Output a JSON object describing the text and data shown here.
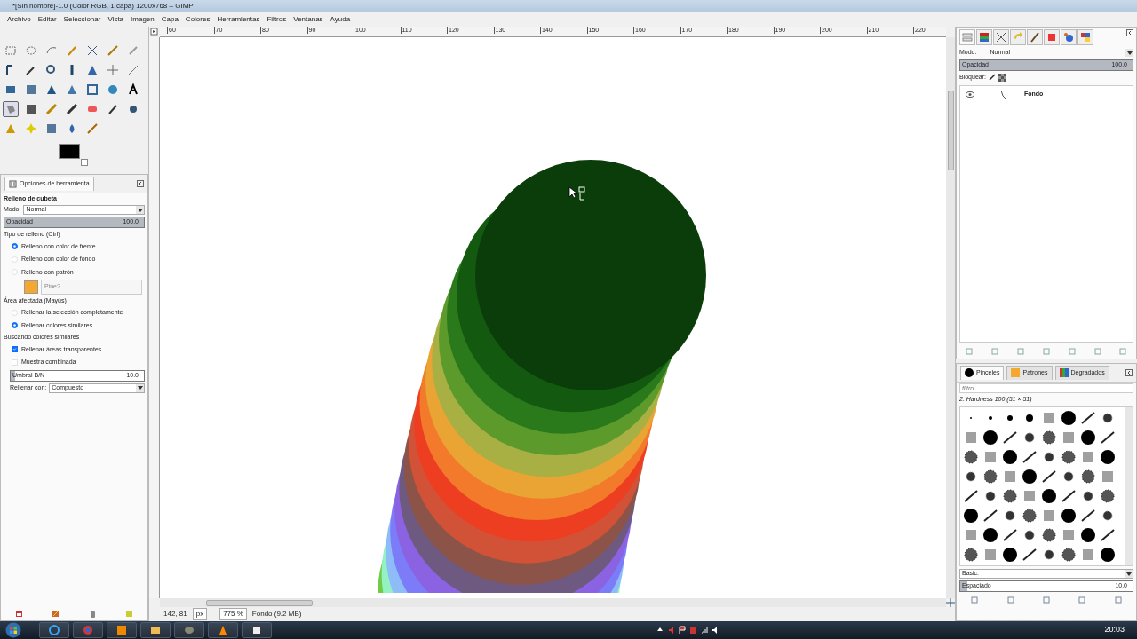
{
  "window": {
    "title": "*[Sin nombre]-1.0 (Color RGB, 1 capa) 1200x768 – GIMP"
  },
  "menu": [
    "Archivo",
    "Editar",
    "Seleccionar",
    "Vista",
    "Imagen",
    "Capa",
    "Colores",
    "Herramientas",
    "Filtros",
    "Ventanas",
    "Ayuda"
  ],
  "toolbox": {
    "tools": [
      {
        "selected": false
      },
      {
        "selected": false
      },
      {
        "selected": false
      },
      {
        "selected": false
      },
      {
        "selected": false
      },
      {
        "selected": false
      },
      {
        "selected": false
      },
      {
        "selected": false
      },
      {
        "selected": false
      },
      {
        "selected": false
      },
      {
        "selected": false
      },
      {
        "selected": false
      },
      {
        "selected": false
      },
      {
        "selected": false
      },
      {
        "selected": false
      },
      {
        "selected": false
      },
      {
        "selected": false
      },
      {
        "selected": false
      },
      {
        "selected": false
      },
      {
        "selected": false
      },
      {
        "selected": false
      },
      {
        "selected": true
      },
      {
        "selected": false
      },
      {
        "selected": false
      },
      {
        "selected": false
      },
      {
        "selected": false
      },
      {
        "selected": false
      },
      {
        "selected": false
      },
      {
        "selected": false
      },
      {
        "selected": false
      },
      {
        "selected": false
      },
      {
        "selected": false
      },
      {
        "selected": false
      }
    ]
  },
  "tool_options": {
    "tab": "Opciones de herramienta",
    "title": "Relleno de cubeta",
    "mode_label": "Modo:",
    "mode_value": "Normal",
    "opacity": {
      "label": "Opacidad",
      "value": "100.0",
      "level": 1.0
    },
    "fill_type_label": "Tipo de relleno  (Ctrl)",
    "fill_type": [
      {
        "label": "Relleno con color de frente",
        "selected": true
      },
      {
        "label": "Relleno con color de fondo",
        "selected": false
      },
      {
        "label": "Relleno con patrón",
        "selected": false
      }
    ],
    "pattern": "Pine?",
    "area_label": "Área afectada  (Mayús)",
    "area": [
      {
        "label": "Rellenar la selección completamente",
        "selected": false
      },
      {
        "label": "Rellenar colores similares",
        "selected": true
      }
    ],
    "similar_label": "Buscando colores similares",
    "checks": [
      {
        "label": "Rellenar áreas transparentes",
        "checked": true
      },
      {
        "label": "Muestra combinada",
        "checked": false
      }
    ],
    "threshold": {
      "label": "Umbral B/N",
      "value": "10.0",
      "level": 0.03
    },
    "fill_with_label": "Rellenar con:",
    "fill_with_value": "Compuesto"
  },
  "canvas": {
    "ruler_labels": [
      "60",
      "70",
      "80",
      "90",
      "100",
      "110",
      "120",
      "130",
      "140",
      "150",
      "160",
      "170",
      "180",
      "190",
      "200",
      "210",
      "220"
    ]
  },
  "status_bar": {
    "coords": "142, 81",
    "unit": "px",
    "zoom": "775 %",
    "info": "Fondo (9.2 MB)"
  },
  "layers": {
    "dock_tabs": [
      {
        "selected": true
      },
      {
        "selected": false
      },
      {
        "selected": false
      },
      {
        "selected": false
      },
      {
        "selected": false
      },
      {
        "selected": false
      },
      {
        "selected": false
      },
      {
        "selected": false
      }
    ],
    "mode_label": "Modo:",
    "mode_value": "Normal",
    "opacity": {
      "label": "Opacidad",
      "value": "100.0",
      "level": 1.0
    },
    "lock_label": "Bloquear:",
    "items": [
      {
        "name": "Fondo",
        "visible": true
      }
    ]
  },
  "brushes": {
    "tabs": [
      {
        "label": "Pinceles",
        "selected": true
      },
      {
        "label": "Patrones",
        "selected": false
      },
      {
        "label": "Degradados",
        "selected": false
      }
    ],
    "filter_placeholder": "filtro",
    "brush_name": "2. Hardness 100 (51 × 51)",
    "preset": "Basic.",
    "spacing": {
      "label": "Espaciado",
      "value": "10.0",
      "level": 0.04
    }
  },
  "taskbar": {
    "clock": "20:03"
  }
}
